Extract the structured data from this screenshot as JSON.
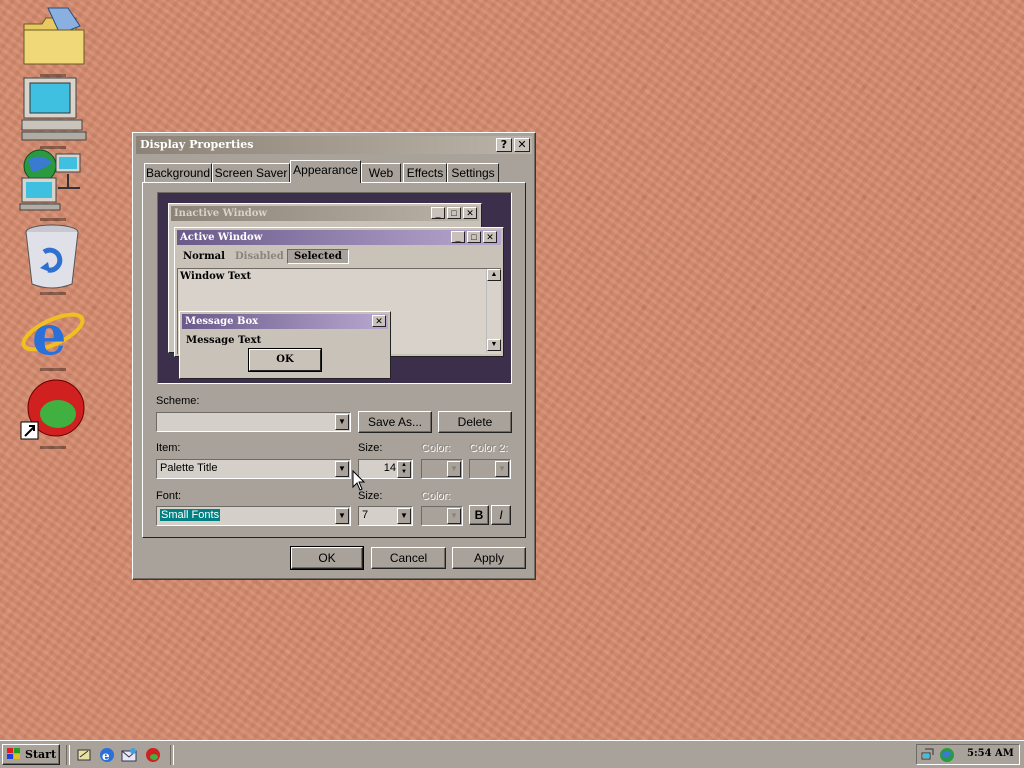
{
  "dialog": {
    "title": "Display Properties",
    "help_glyph": "?",
    "close_glyph": "✕",
    "tabs": [
      {
        "label": "Background"
      },
      {
        "label": "Screen Saver"
      },
      {
        "label": "Appearance"
      },
      {
        "label": "Web"
      },
      {
        "label": "Effects"
      },
      {
        "label": "Settings"
      }
    ],
    "active_tab": "Appearance",
    "preview": {
      "inactive_title": "Inactive Window",
      "active_title": "Active Window",
      "menu_items": [
        "Normal",
        "Disabled",
        "Selected"
      ],
      "window_text": "Window Text",
      "msg_title": "Message Box",
      "msg_text": "Message Text",
      "msg_ok": "OK"
    },
    "scheme_label": "Scheme:",
    "scheme_value": "",
    "save_as_label": "Save As...",
    "delete_label": "Delete",
    "item_label": "Item:",
    "item_value": "Palette Title",
    "size_label": "Size:",
    "size_value": "14",
    "color_label": "Color:",
    "color2_label": "Color 2:",
    "font_label": "Font:",
    "font_value": "Small Fonts",
    "font_size_label": "Size:",
    "font_size_value": "7",
    "font_color_label": "Color:",
    "bold_label": "B",
    "italic_label": "I",
    "ok_label": "OK",
    "cancel_label": "Cancel",
    "apply_label": "Apply"
  },
  "taskbar": {
    "start_label": "Start",
    "clock": "5:54 AM"
  },
  "desktop_icons": [
    "my-documents-icon",
    "my-computer-icon",
    "network-neighborhood-icon",
    "recycle-bin-icon",
    "internet-explorer-icon",
    "shortcut-app-icon"
  ],
  "colors": {
    "desktop": "#d4896c",
    "dialog_face": "#a8a29b",
    "active_title_from": "#6a5a8a",
    "active_title_to": "#b8a8d0",
    "selection": "#008080"
  }
}
